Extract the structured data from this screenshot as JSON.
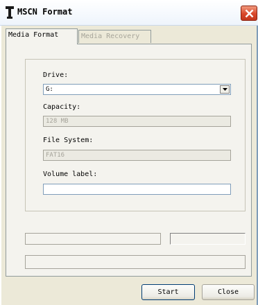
{
  "window": {
    "title": "MSCN Format",
    "app_icon": "tool-icon",
    "close_icon": "close-icon"
  },
  "tabs": [
    {
      "label": "Media Format",
      "active": true
    },
    {
      "label": "Media Recovery",
      "active": false
    }
  ],
  "form": {
    "drive_label": "Drive:",
    "drive_value": "G:",
    "capacity_label": "Capacity:",
    "capacity_value": "128 MB",
    "filesystem_label": "File System:",
    "filesystem_value": "FAT16",
    "volume_label": "Volume label:",
    "volume_value": ""
  },
  "buttons": {
    "start": "Start",
    "close": "Close"
  }
}
